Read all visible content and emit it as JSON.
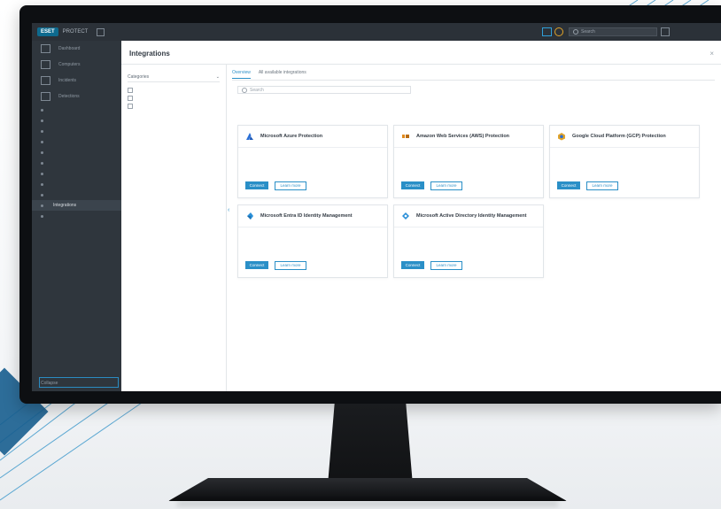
{
  "app": {
    "logo": "ESET",
    "product": "PROTECT",
    "search_placeholder": "Search",
    "top_links": [
      "",
      "",
      "",
      ""
    ]
  },
  "sidebar": {
    "items": [
      {
        "label": "Dashboard",
        "icon": "dashboard-icon",
        "active": false
      },
      {
        "label": "Computers",
        "icon": "computers-icon",
        "active": false
      },
      {
        "label": "Incidents",
        "icon": "incidents-icon",
        "active": false
      },
      {
        "label": "Detections",
        "icon": "detections-icon",
        "active": false
      },
      {
        "label": "",
        "icon": "",
        "active": false
      },
      {
        "label": "",
        "icon": "",
        "active": false
      },
      {
        "label": "",
        "icon": "",
        "active": false,
        "badge": ""
      },
      {
        "label": "",
        "icon": "",
        "active": false
      },
      {
        "label": "",
        "icon": "",
        "active": false
      },
      {
        "label": "",
        "icon": "",
        "active": false
      },
      {
        "label": "",
        "icon": "",
        "active": false
      },
      {
        "label": "",
        "icon": "",
        "active": false
      },
      {
        "label": "",
        "icon": "",
        "active": false
      },
      {
        "label": "Integrations",
        "icon": "integrations-icon",
        "active": true
      },
      {
        "label": "",
        "icon": "",
        "active": false
      },
      {
        "label": "",
        "icon": "",
        "active": false
      }
    ],
    "bottom_button": "",
    "collapse": "Collapse"
  },
  "main": {
    "title": "Integrations",
    "categories_header": "Categories",
    "categories": [
      "",
      "",
      ""
    ],
    "tabs": [
      "Overview",
      "All available integrations"
    ],
    "search_placeholder": "Search",
    "cards": [
      {
        "title": "Microsoft Azure Protection",
        "desc": "",
        "icon_color": "#2a6fd6",
        "primary": "Connect",
        "secondary": "Learn more"
      },
      {
        "title": "Amazon Web Services (AWS) Protection",
        "desc": "",
        "icon_color": "#e08a1e",
        "primary": "Connect",
        "secondary": "Learn more"
      },
      {
        "title": "Google Cloud Platform (GCP) Protection",
        "desc": "",
        "icon_color": "#e0a32a",
        "primary": "Connect",
        "secondary": "Learn more"
      },
      {
        "title": "Microsoft Entra ID Identity Management",
        "desc": "",
        "icon_color": "#2a8fd8",
        "primary": "Connect",
        "secondary": "Learn more"
      },
      {
        "title": "Microsoft Active Directory Identity Management",
        "desc": "",
        "icon_color": "#2a8fd8",
        "primary": "Connect",
        "secondary": "Learn more"
      }
    ]
  }
}
